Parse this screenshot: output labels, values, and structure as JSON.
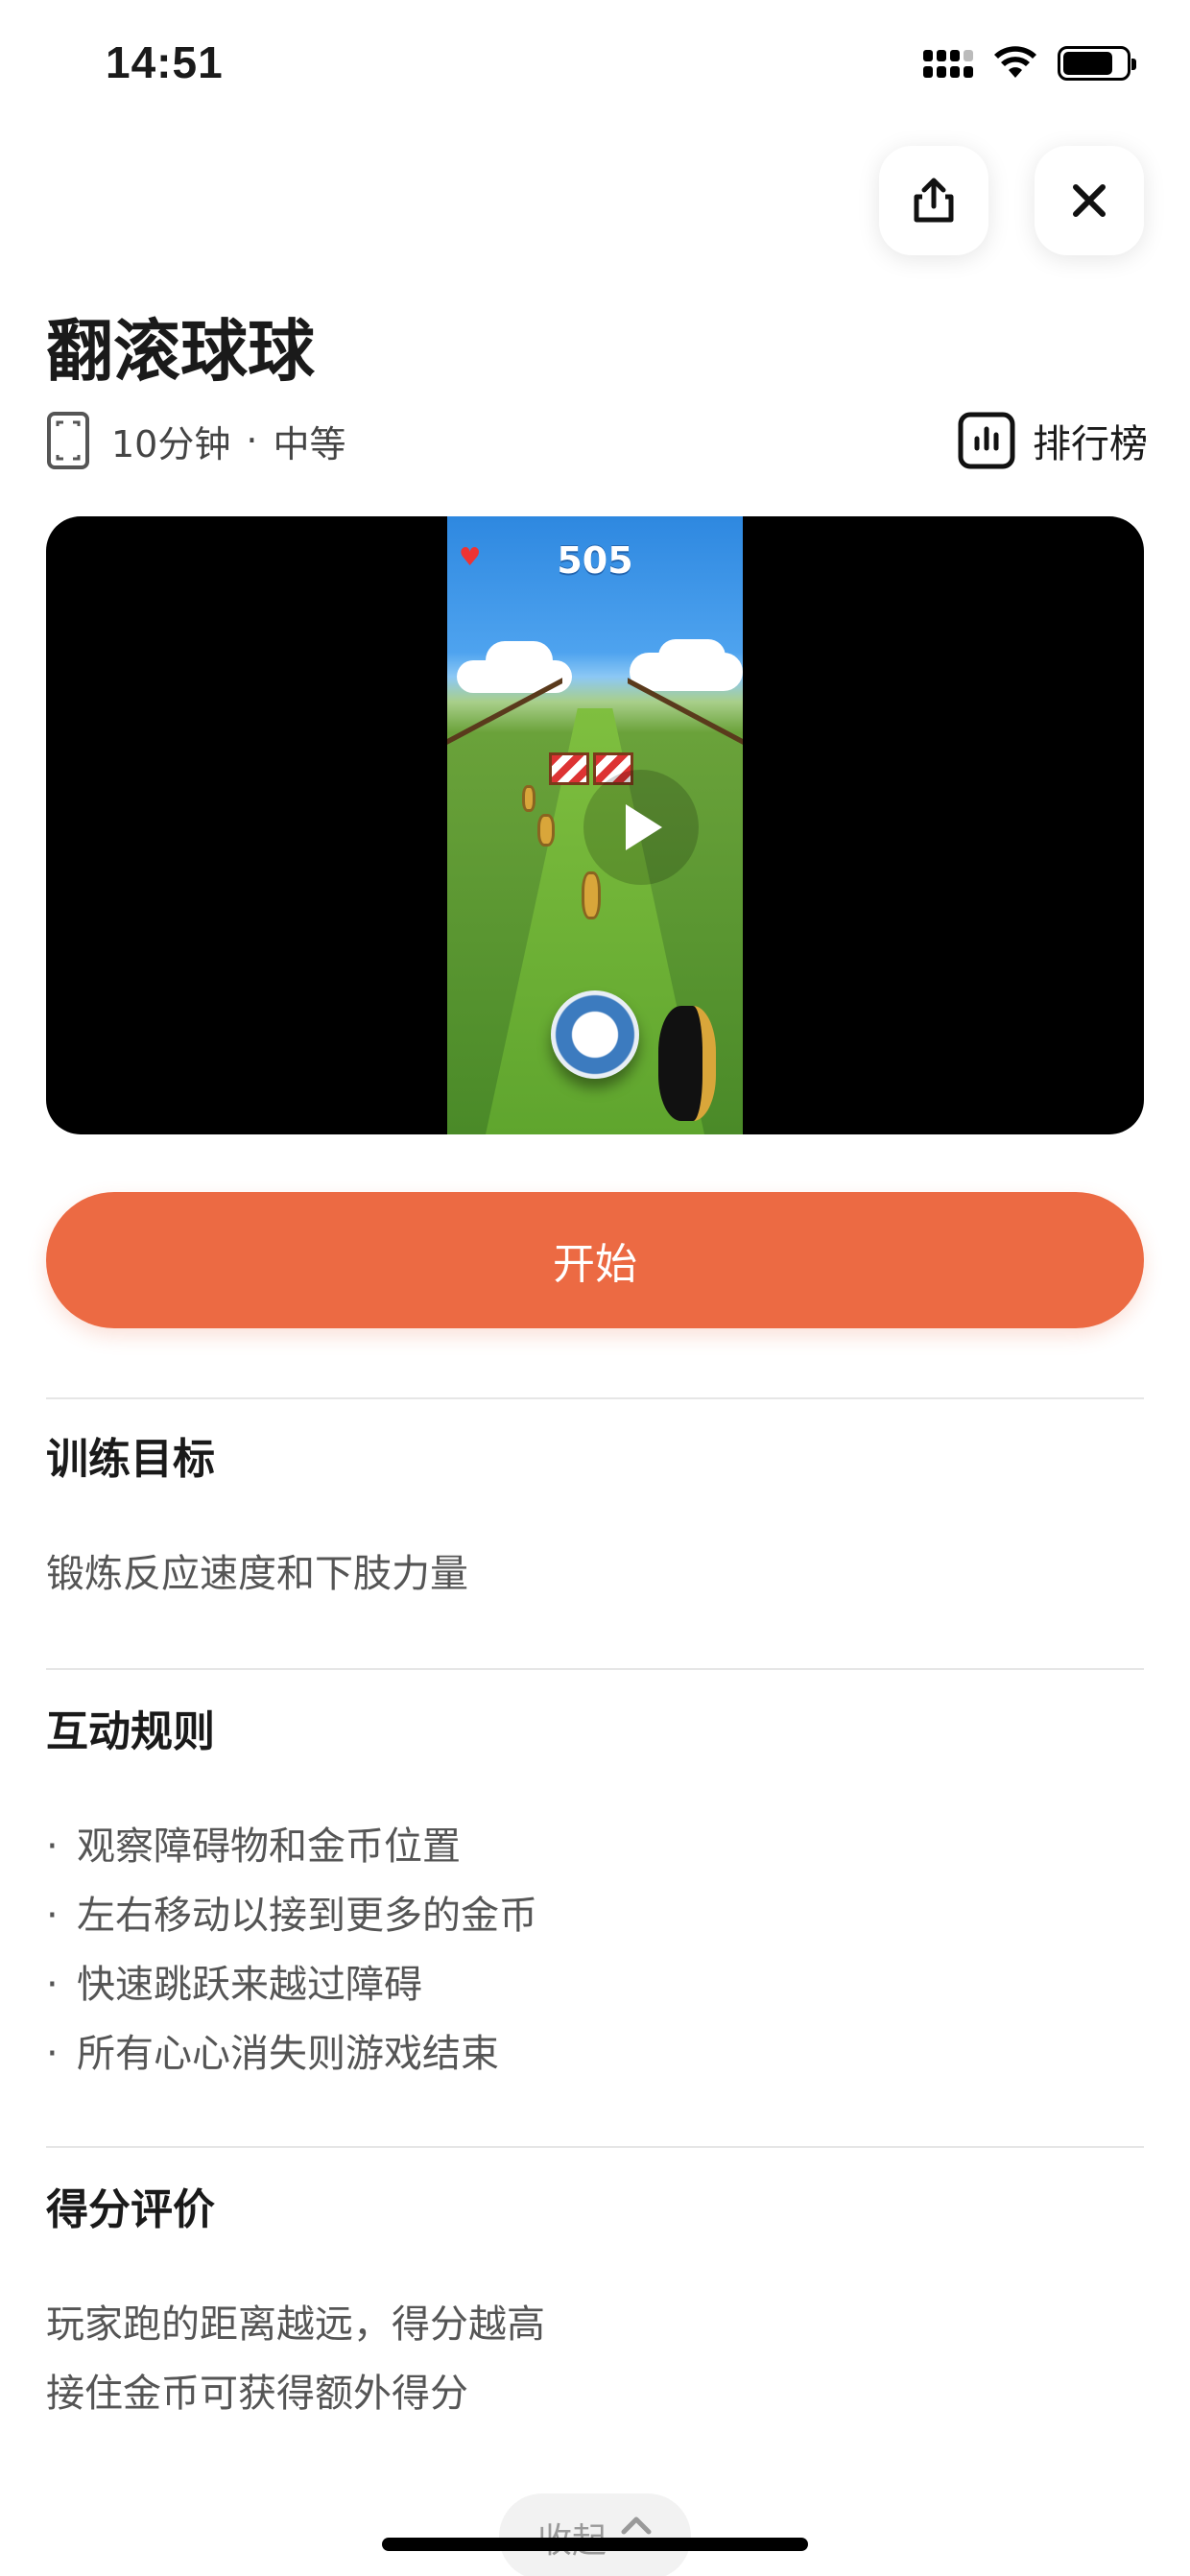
{
  "status_bar": {
    "time": "14:51"
  },
  "header": {
    "share_icon": "share-icon",
    "close_icon": "close-icon"
  },
  "game": {
    "title": "翻滚球球",
    "duration": "10分钟",
    "separator": "·",
    "difficulty": "中等",
    "leaderboard_label": "排行榜"
  },
  "video": {
    "score": "505"
  },
  "start_button": {
    "label": "开始"
  },
  "sections": {
    "goal": {
      "title": "训练目标",
      "text": "锻炼反应速度和下肢力量"
    },
    "rules": {
      "title": "互动规则",
      "bullet": "·",
      "items": [
        "观察障碍物和金币位置",
        "左右移动以接到更多的金币",
        "快速跳跃来越过障碍",
        "所有心心消失则游戏结束"
      ]
    },
    "scoring": {
      "title": "得分评价",
      "lines": [
        "玩家跑的距离越远，得分越高",
        "接住金币可获得额外得分"
      ]
    }
  },
  "collapse": {
    "label": "收起"
  },
  "colors": {
    "accent": "#ec6a43"
  }
}
